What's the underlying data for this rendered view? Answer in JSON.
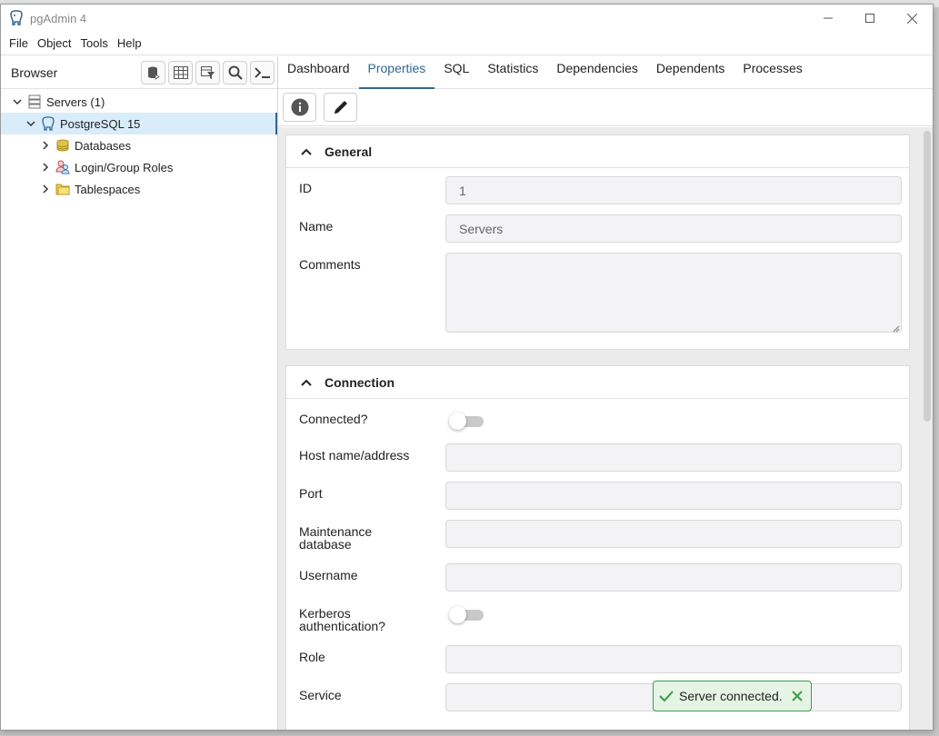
{
  "window": {
    "title": "pgAdmin 4"
  },
  "menu": [
    "File",
    "Object",
    "Tools",
    "Help"
  ],
  "browser": {
    "label": "Browser",
    "tree": {
      "servers": "Servers (1)",
      "server": "PostgreSQL 15",
      "children": [
        "Databases",
        "Login/Group Roles",
        "Tablespaces"
      ]
    }
  },
  "tabs": [
    "Dashboard",
    "Properties",
    "SQL",
    "Statistics",
    "Dependencies",
    "Dependents",
    "Processes"
  ],
  "active_tab": "Properties",
  "general": {
    "title": "General",
    "id_label": "ID",
    "id_value": "1",
    "name_label": "Name",
    "name_value": "Servers",
    "comments_label": "Comments",
    "comments_value": ""
  },
  "connection": {
    "title": "Connection",
    "connected_label": "Connected?",
    "connected": false,
    "host_label": "Host name/address",
    "host_value": "",
    "port_label": "Port",
    "port_value": "",
    "maint_label_1": "Maintenance",
    "maint_label_2": "database",
    "maint_value": "",
    "username_label": "Username",
    "username_value": "",
    "kerberos_label_1": "Kerberos",
    "kerberos_label_2": "authentication?",
    "kerberos": false,
    "role_label": "Role",
    "role_value": "",
    "service_label": "Service",
    "service_value": ""
  },
  "toast": {
    "message": "Server connected."
  },
  "colors": {
    "accent": "#326690",
    "success": "#3a9d46"
  }
}
